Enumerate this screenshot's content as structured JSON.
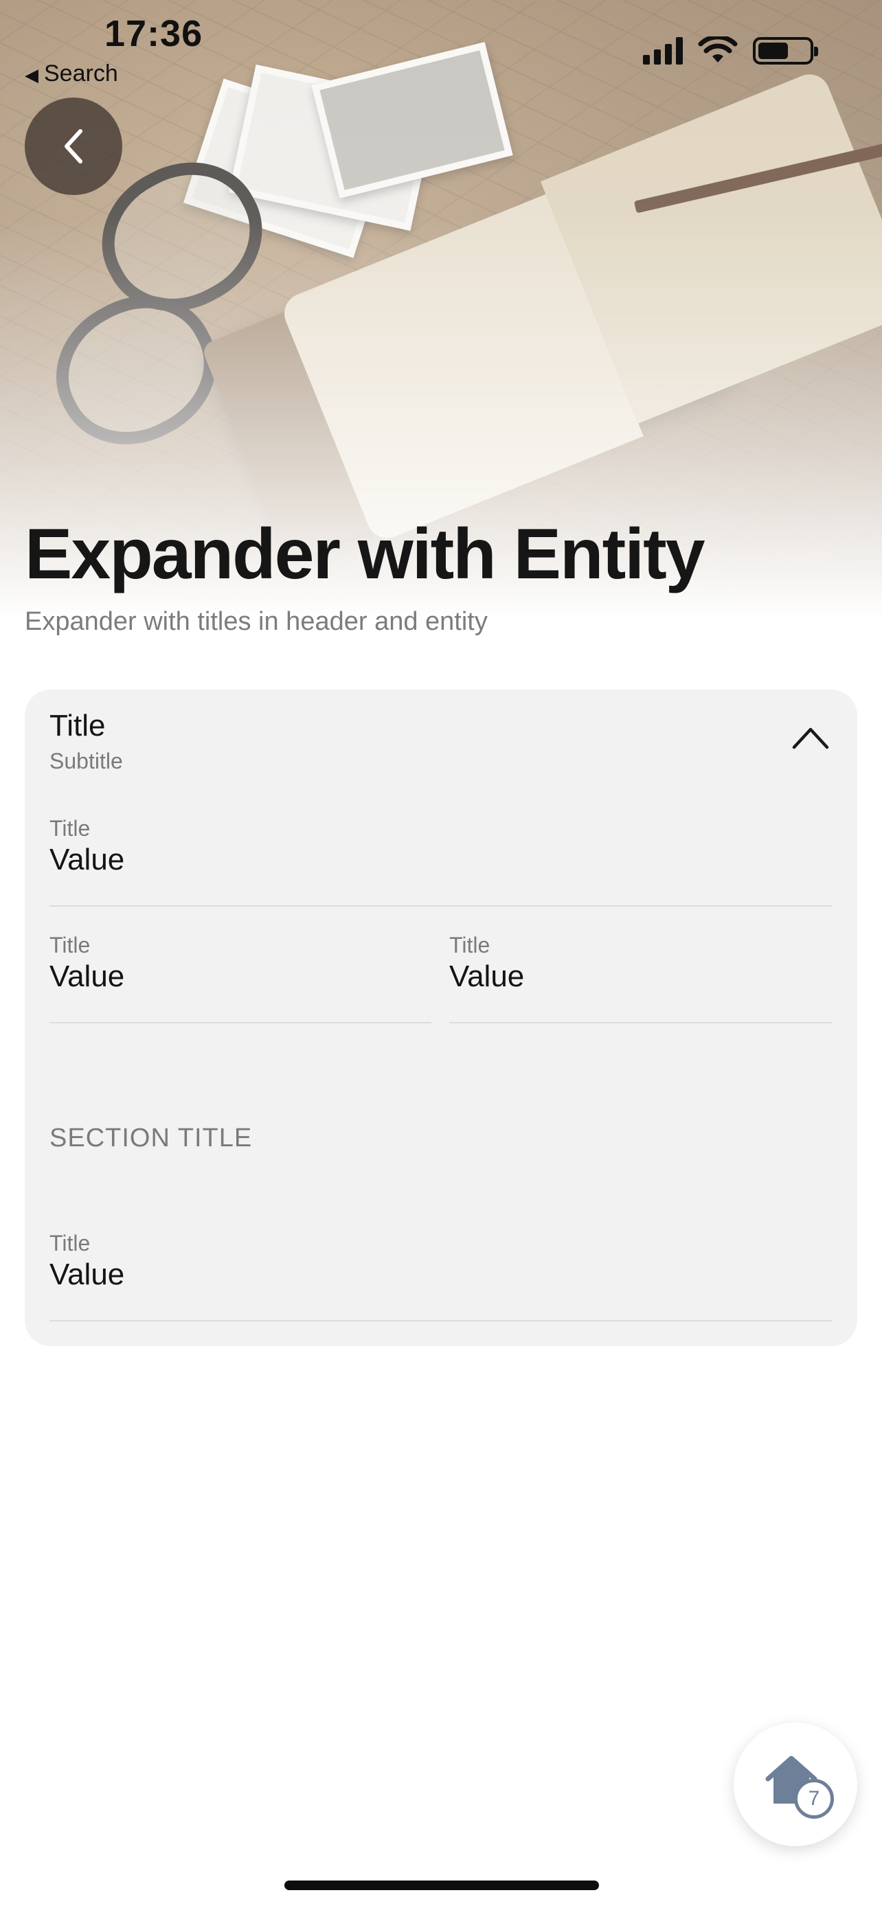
{
  "status_bar": {
    "time": "17:36",
    "back_label": "Search",
    "back_glyph": "◀"
  },
  "header": {
    "back_icon": "chevron-left-icon",
    "title": "Expander with Entity",
    "subtitle": "Expander with titles in header and entity"
  },
  "expander": {
    "title": "Title",
    "subtitle": "Subtitle",
    "state": "expanded",
    "fields": [
      {
        "title": "Title",
        "value": "Value"
      },
      {
        "title": "Title",
        "value": "Value"
      },
      {
        "title": "Title",
        "value": "Value"
      }
    ],
    "section": {
      "title": "SECTION TITLE",
      "fields": [
        {
          "title": "Title",
          "value": "Value"
        }
      ]
    }
  },
  "fab": {
    "icon": "home-icon",
    "badge": "7",
    "color": "#6d7f99"
  }
}
